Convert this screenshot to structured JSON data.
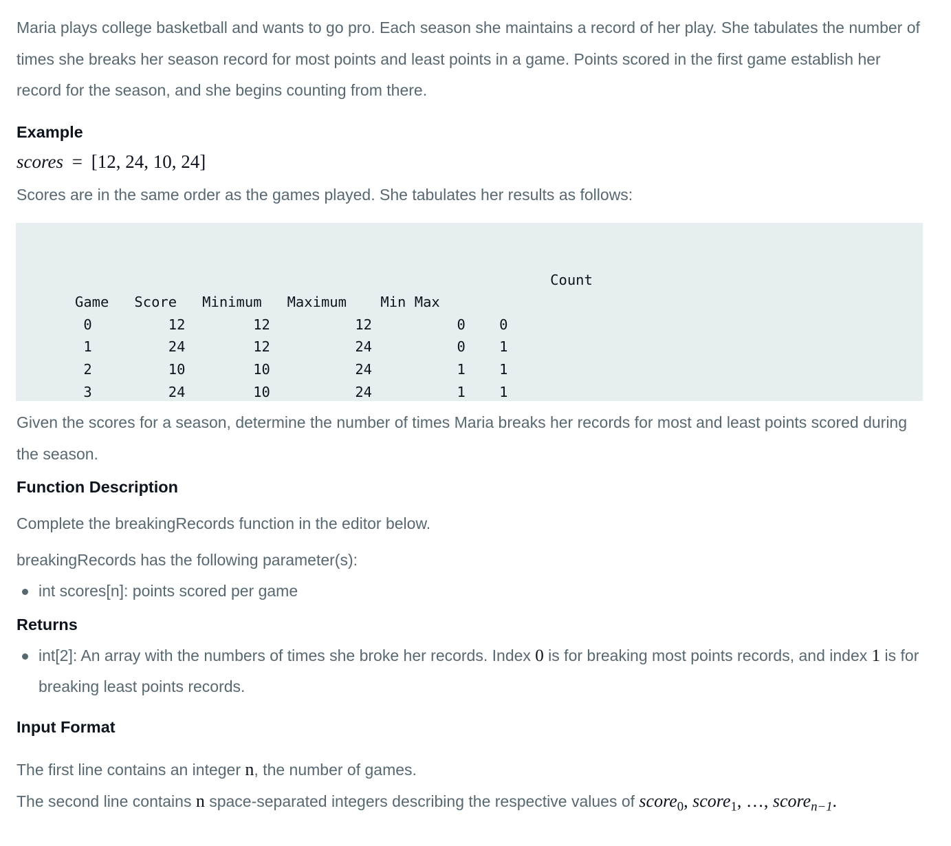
{
  "intro": "Maria plays college basketball and wants to go pro. Each season she maintains a record of her play. She tabulates the number of times she breaks her season record for most points and least points in a game. Points scored in the first game establish her record for the season, and she begins counting from there.",
  "example": {
    "heading": "Example",
    "var_name": "scores",
    "equals": "=",
    "value": "[12, 24, 10, 24]",
    "description": "Scores are in the same order as the games played. She tabulates her results as follows:"
  },
  "table": {
    "count_header": "Count",
    "headers": [
      "Game",
      "Score",
      "Minimum",
      "Maximum",
      "Min",
      "Max"
    ],
    "rows": [
      [
        "0",
        "12",
        "12",
        "12",
        "0",
        "0"
      ],
      [
        "1",
        "24",
        "12",
        "24",
        "0",
        "1"
      ],
      [
        "2",
        "10",
        "10",
        "24",
        "1",
        "1"
      ],
      [
        "3",
        "24",
        "10",
        "24",
        "1",
        "1"
      ]
    ]
  },
  "task": "Given the scores for a season, determine the number of times Maria breaks her records for most and least points scored during the season.",
  "function_description": {
    "heading": "Function Description",
    "line1": "Complete the breakingRecords function in the editor below.",
    "line2": "breakingRecords has the following parameter(s):",
    "params": [
      "int scores[n]: points scored per game"
    ]
  },
  "returns": {
    "heading": "Returns",
    "text_a": "int[2]: An array with the numbers of times she broke her records. Index ",
    "index0": "0",
    "text_b": " is for breaking most points records, and index ",
    "index1": "1",
    "text_c": " is for breaking least points records."
  },
  "input_format": {
    "heading": "Input Format",
    "line1_a": "The first line contains an integer ",
    "n": "n",
    "line1_b": ", the number of games.",
    "line2_a": "The second line contains ",
    "line2_b": " space-separated integers describing the respective values of ",
    "score_var": "score",
    "sub0": "0",
    "sub1": "1",
    "subn": "n−1",
    "sep": ", ",
    "ellipsis": "…",
    "period": "."
  }
}
